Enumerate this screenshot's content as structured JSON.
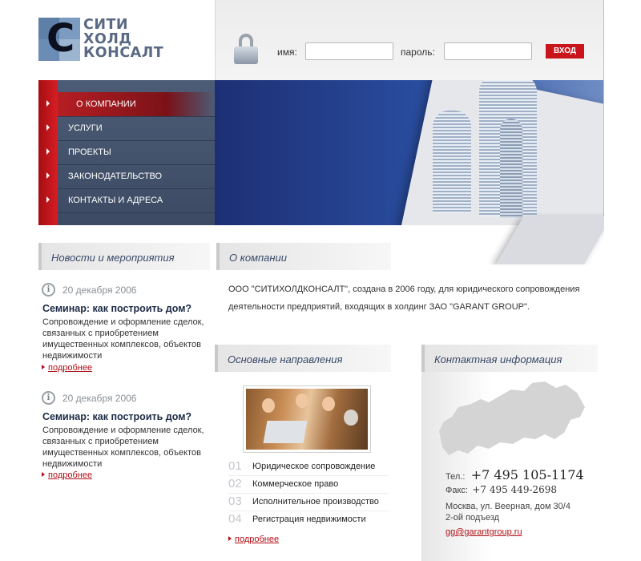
{
  "logo": {
    "letter": "С",
    "lines": [
      "СИТИ",
      "ХОЛД",
      "КОНСАЛТ"
    ]
  },
  "login": {
    "name_label": "имя:",
    "password_label": "пароль:",
    "name_value": "",
    "password_value": "",
    "submit_label": "ВХОД"
  },
  "nav": {
    "items": [
      {
        "label": "О КОМПАНИИ",
        "active": true
      },
      {
        "label": "УСЛУГИ"
      },
      {
        "label": "ПРОЕКТЫ"
      },
      {
        "label": "ЗАКОНОДАТЕЛЬСТВО"
      },
      {
        "label": "КОНТАКТЫ И АДРЕСА"
      }
    ]
  },
  "news": {
    "title": "Новости и мероприятия",
    "items": [
      {
        "date": "20 декабря 2006",
        "title": "Семинар: как построить дом?",
        "body": "Сопровождение и оформление сделок, связанных с приобретением имущественных комплексов, объектов недвижимости",
        "more": "подробнее"
      },
      {
        "date": "20 декабря 2006",
        "title": "Семинар: как построить дом?",
        "body": "Сопровождение и оформление сделок, связанных с приобретением имущественных комплексов, объектов недвижимости",
        "more": "подробнее"
      }
    ]
  },
  "about": {
    "title": "О компании",
    "text": "ООО \"СИТИХОЛДКОНСАЛТ\", создана в 2006 году, для юридического сопровождения деятельности предприятий, входящих в холдинг ЗАО \"GARANT GROUP\"."
  },
  "directions": {
    "title": "Основные направления",
    "items": [
      {
        "num": "01",
        "label": "Юридическое сопровождение"
      },
      {
        "num": "02",
        "label": "Коммерческое право"
      },
      {
        "num": "03",
        "label": "Исполнительное производство"
      },
      {
        "num": "04",
        "label": "Регистрация недвижимости"
      }
    ],
    "more": "подробнее"
  },
  "contacts": {
    "title": "Контактная информация",
    "phone_label": "Тел.:",
    "phone": "+7 495 105-1174",
    "fax_label": "Факс:",
    "fax": "+7 495 449-2698",
    "address_line1": "Москва, ул. Веерная, дом 30/4",
    "address_line2": "2-ой подъезд",
    "email": "gg@garantgroup.ru"
  },
  "colors": {
    "accent": "#c8141a",
    "nav_bg": "#45536c",
    "heading": "#3a4a6a"
  }
}
